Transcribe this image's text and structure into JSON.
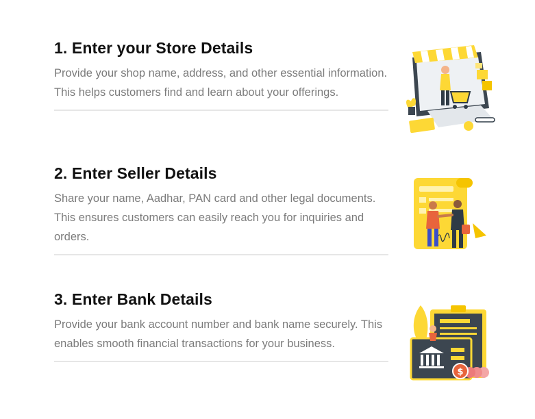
{
  "steps": [
    {
      "title": "1. Enter your Store Details",
      "description": "Provide your shop name, address, and other essential information. This helps customers find and learn about your offerings.",
      "illustration": "online-store-icon"
    },
    {
      "title": "2. Enter Seller Details",
      "description": "Share your name, Aadhar, PAN card and other legal documents. This ensures customers can easily reach you for inquiries and orders.",
      "illustration": "handshake-document-icon"
    },
    {
      "title": "3. Enter Bank Details",
      "description": "Provide your bank account number and bank name securely. This enables smooth financial transactions for your business.",
      "illustration": "bank-card-icon"
    }
  ],
  "colors": {
    "accent": "#fdd835",
    "accent_dark": "#f5c400",
    "title": "#111111",
    "text": "#7b7b7b",
    "divider": "#e6e6e6",
    "ink": "#2f3b46"
  }
}
